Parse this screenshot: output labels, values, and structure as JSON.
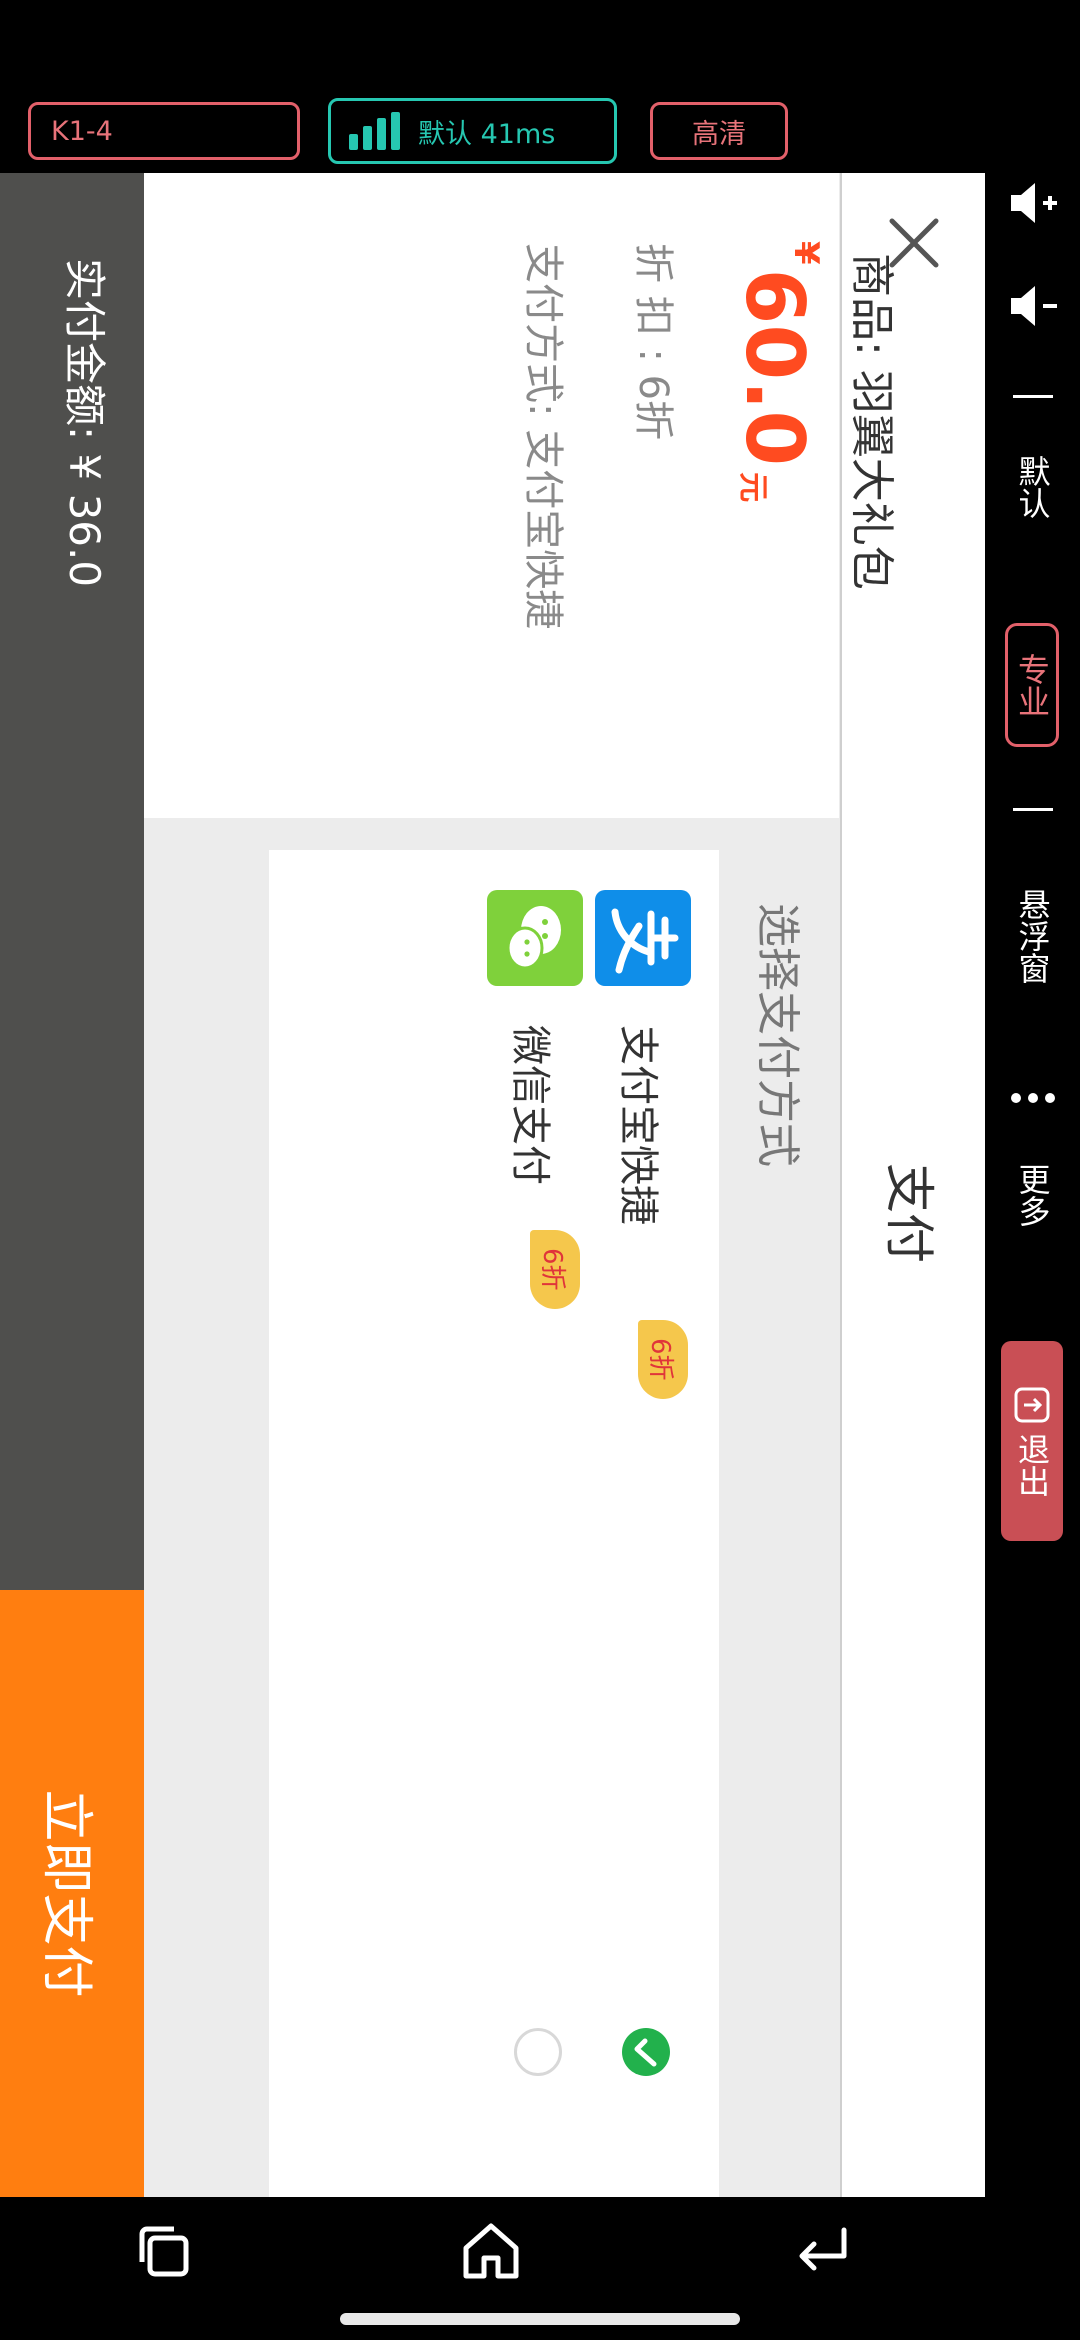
{
  "top_bar": {
    "channel": "K1-4",
    "network": "默认 41ms",
    "quality": "高清",
    "colors": {
      "pink": "#e8737a",
      "teal": "#26c7b1"
    }
  },
  "payment": {
    "title": "支付",
    "product": "商品: 羽翼大礼包",
    "price_symbol": "¥",
    "price": "60.0",
    "price_unit": "元",
    "discount": "折 扣 :  6折",
    "method": "支付方式:  支付宝快捷",
    "select_heading": "选择支付方式",
    "methods": [
      {
        "label": "支付宝快捷",
        "badge": "6折",
        "selected": true,
        "icon": "alipay-icon"
      },
      {
        "label": "微信支付",
        "badge": "6折",
        "selected": false,
        "icon": "wechat-pay-icon"
      }
    ],
    "total": "实付金额: ¥ 36.0",
    "pay_button": "立即支付",
    "colors": {
      "price": "#ff4b20",
      "button": "#ff7e10",
      "bar": "#4f4f4d",
      "badge": "#f5c74c"
    }
  },
  "side_toolbar": {
    "default": "默认",
    "pro": "专业",
    "float_window": "悬浮窗",
    "more": "更多",
    "exit": "退出",
    "icons": [
      "volume-up-icon",
      "volume-down-icon",
      "more-dots-icon",
      "exit-icon"
    ]
  },
  "nav_bar": {
    "icons": [
      "recents-icon",
      "home-icon",
      "back-icon"
    ]
  }
}
